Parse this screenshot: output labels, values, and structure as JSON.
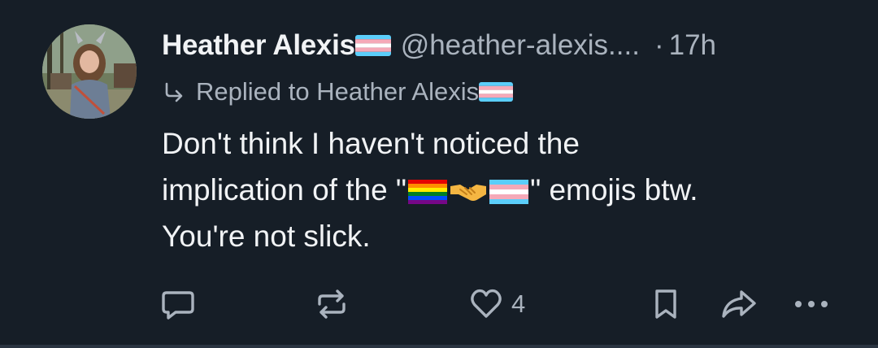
{
  "post": {
    "author": {
      "display_name": "Heather Alexis",
      "handle": "@heather-alexis....",
      "avatar_icon": "profile-photo"
    },
    "separator": "·",
    "time": "17h",
    "reply": {
      "label": "Replied to Heather Alexis"
    },
    "body": {
      "line1": "Don't think I haven't noticed the",
      "line2_before": "implication of the \"",
      "line2_after": "\" emojis btw.",
      "line3": "You're not slick.",
      "emojis": [
        "rainbow-flag",
        "handshake",
        "transgender-flag"
      ]
    },
    "actions": {
      "reply_icon": "speech-bubble-icon",
      "repost_icon": "repost-icon",
      "like_icon": "heart-icon",
      "like_count": "4",
      "bookmark_icon": "bookmark-icon",
      "share_icon": "share-arrow-icon",
      "more_label": "•••"
    }
  },
  "colors": {
    "background": "#161e27",
    "text_primary": "#f1f3f5",
    "text_secondary": "#aab3be",
    "trans_blue": "#5bcefa",
    "trans_pink": "#f5a9b8"
  }
}
